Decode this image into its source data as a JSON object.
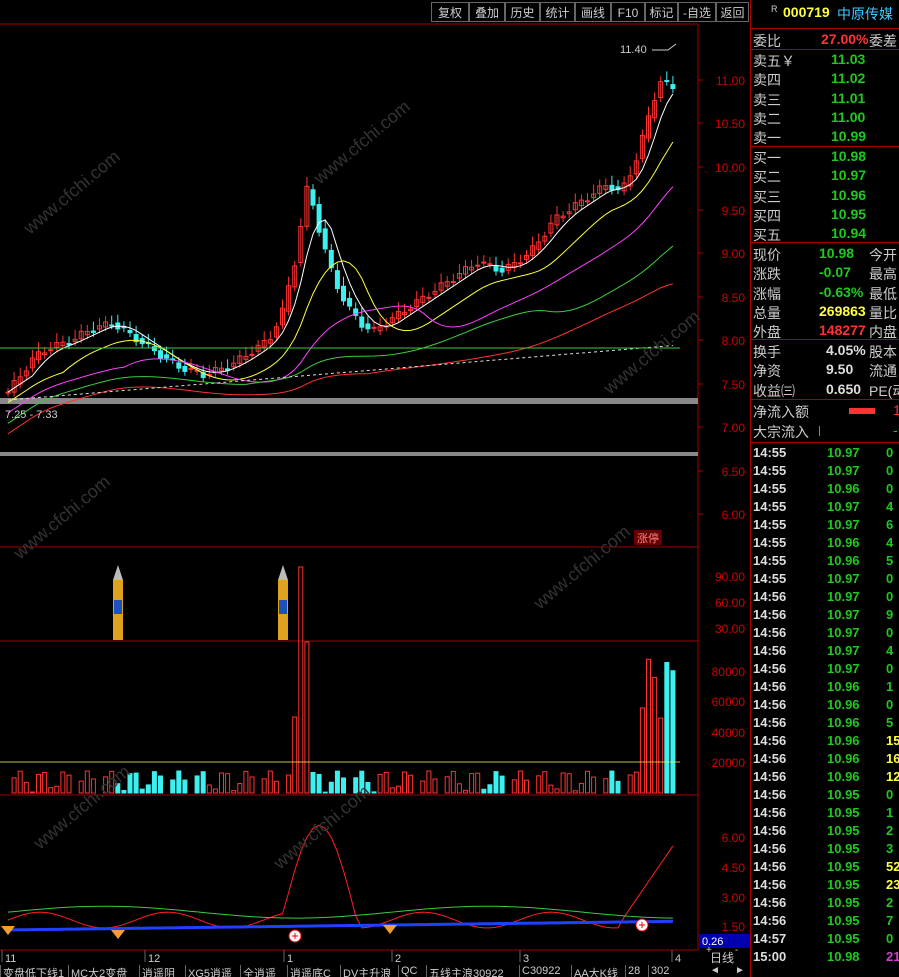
{
  "toolbar": [
    "复权",
    "叠加",
    "历史",
    "统计",
    "画线",
    "F10",
    "标记",
    "-自选",
    "返回"
  ],
  "stock": {
    "badge": "R",
    "code": "000719",
    "name": "中原传媒"
  },
  "committee": {
    "label": "委比",
    "value": "27.00%",
    "label2": "委差"
  },
  "asks": [
    {
      "label": "卖五￥",
      "price": "11.03"
    },
    {
      "label": "卖四",
      "price": "11.02"
    },
    {
      "label": "卖三",
      "price": "11.01"
    },
    {
      "label": "卖二",
      "price": "11.00"
    },
    {
      "label": "卖一",
      "price": "10.99"
    }
  ],
  "bids": [
    {
      "label": "买一",
      "price": "10.98"
    },
    {
      "label": "买二",
      "price": "10.97"
    },
    {
      "label": "买三",
      "price": "10.96"
    },
    {
      "label": "买四",
      "price": "10.95"
    },
    {
      "label": "买五",
      "price": "10.94"
    }
  ],
  "quote": [
    {
      "label": "现价",
      "value": "10.98",
      "label2": "今开",
      "color": "#1ec81e"
    },
    {
      "label": "涨跌",
      "value": "-0.07",
      "label2": "最高",
      "color": "#1ec81e"
    },
    {
      "label": "涨幅",
      "value": "-0.63%",
      "label2": "最低",
      "color": "#1ec81e"
    },
    {
      "label": "总量",
      "value": "269863",
      "label2": "量比",
      "color": "#ffff3c"
    },
    {
      "label": "外盘",
      "value": "148277",
      "label2": "内盘",
      "color": "#ff3232"
    }
  ],
  "fundamentals": [
    {
      "label": "换手",
      "value": "4.05%",
      "label2": "股本"
    },
    {
      "label": "净资",
      "value": "9.50",
      "label2": "流通"
    },
    {
      "label": "收益㈢",
      "value": "0.650",
      "label2": "PE(动"
    }
  ],
  "flows": [
    {
      "label": "净流入额",
      "value": "1"
    },
    {
      "label": "大宗流入",
      "value": "-"
    }
  ],
  "ticks": [
    {
      "time": "14:55",
      "price": "10.97",
      "vol": "0",
      "color": "#1ec81e"
    },
    {
      "time": "14:55",
      "price": "10.97",
      "vol": "0",
      "color": "#1ec81e"
    },
    {
      "time": "14:55",
      "price": "10.96",
      "vol": "0",
      "color": "#1ec81e"
    },
    {
      "time": "14:55",
      "price": "10.97",
      "vol": "4",
      "color": "#1ec81e"
    },
    {
      "time": "14:55",
      "price": "10.97",
      "vol": "6",
      "color": "#1ec81e"
    },
    {
      "time": "14:55",
      "price": "10.96",
      "vol": "4",
      "color": "#1ec81e"
    },
    {
      "time": "14:55",
      "price": "10.96",
      "vol": "5",
      "color": "#1ec81e"
    },
    {
      "time": "14:55",
      "price": "10.97",
      "vol": "0",
      "color": "#1ec81e"
    },
    {
      "time": "14:56",
      "price": "10.97",
      "vol": "0",
      "color": "#1ec81e"
    },
    {
      "time": "14:56",
      "price": "10.97",
      "vol": "9",
      "color": "#1ec81e"
    },
    {
      "time": "14:56",
      "price": "10.97",
      "vol": "0",
      "color": "#1ec81e"
    },
    {
      "time": "14:56",
      "price": "10.97",
      "vol": "4",
      "color": "#1ec81e"
    },
    {
      "time": "14:56",
      "price": "10.97",
      "vol": "0",
      "color": "#1ec81e"
    },
    {
      "time": "14:56",
      "price": "10.96",
      "vol": "1",
      "color": "#1ec81e"
    },
    {
      "time": "14:56",
      "price": "10.96",
      "vol": "0",
      "color": "#1ec81e"
    },
    {
      "time": "14:56",
      "price": "10.96",
      "vol": "5",
      "color": "#1ec81e"
    },
    {
      "time": "14:56",
      "price": "10.96",
      "vol": "15",
      "color": "#ffff3c"
    },
    {
      "time": "14:56",
      "price": "10.96",
      "vol": "16",
      "color": "#ffff3c"
    },
    {
      "time": "14:56",
      "price": "10.96",
      "vol": "12",
      "color": "#ffff3c"
    },
    {
      "time": "14:56",
      "price": "10.95",
      "vol": "0",
      "color": "#1ec81e"
    },
    {
      "time": "14:56",
      "price": "10.95",
      "vol": "1",
      "color": "#1ec81e"
    },
    {
      "time": "14:56",
      "price": "10.95",
      "vol": "2",
      "color": "#1ec81e"
    },
    {
      "time": "14:56",
      "price": "10.95",
      "vol": "3",
      "color": "#1ec81e"
    },
    {
      "time": "14:56",
      "price": "10.95",
      "vol": "52",
      "color": "#ffff3c"
    },
    {
      "time": "14:56",
      "price": "10.95",
      "vol": "23",
      "color": "#ffff3c"
    },
    {
      "time": "14:56",
      "price": "10.95",
      "vol": "2",
      "color": "#1ec81e"
    },
    {
      "time": "14:56",
      "price": "10.95",
      "vol": "7",
      "color": "#1ec81e"
    },
    {
      "time": "14:57",
      "price": "10.95",
      "vol": "0",
      "color": "#1ec81e"
    },
    {
      "time": "15:00",
      "price": "10.98",
      "vol": "219",
      "color": "#d040d0"
    }
  ],
  "price_axis": [
    "11.00",
    "10.50",
    "10.00",
    "9.50",
    "9.00",
    "8.50",
    "8.00",
    "7.50",
    "7.00",
    "6.50",
    "6.00"
  ],
  "price_labels": {
    "high": "11.40",
    "low": "7.25 - 7.33",
    "tag": "涨停"
  },
  "ind1_axis": [
    "90.00",
    "60.00",
    "30.00"
  ],
  "vol_axis": [
    "80000",
    "60000",
    "40000",
    "20000"
  ],
  "ind3_axis": [
    "6.00",
    "4.50",
    "3.00",
    "1.50"
  ],
  "ind3_value": "0.26",
  "date_labels": [
    "11",
    "12",
    "1",
    "2",
    "3",
    "4"
  ],
  "period": "日线",
  "nav": [
    "+",
    "-",
    "◄",
    "►"
  ],
  "tabs": [
    "变盘低下线1",
    "MC大2变盘",
    "逍遥阴",
    "XG5逍遥",
    "全逍遥",
    "逍遥底C",
    "DV主升浪",
    "QC",
    "五线主浪30922",
    "C30922",
    "AA大K线",
    "28",
    "302"
  ],
  "watermark": "www.cfchi.com"
}
